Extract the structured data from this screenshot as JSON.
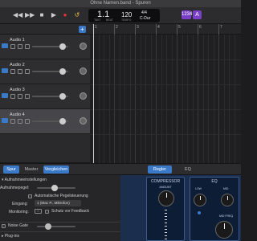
{
  "window": {
    "title": "Ohne Namen.band - Spuren"
  },
  "transport": {
    "rewind": "◀◀",
    "forward": "▶▶",
    "stop": "■",
    "play": "▶",
    "record": "●",
    "cycle": "↺"
  },
  "lcd": {
    "position": "1.1",
    "bar_label": "TAKT",
    "beat_label": "BEAT",
    "tempo": "120",
    "tempo_label": "TEMPO",
    "signature": "4/4",
    "key": "C-Dur"
  },
  "badges": {
    "count_in": "1234",
    "tuner": "A"
  },
  "track_header": {
    "add": "+"
  },
  "ruler": {
    "marks": [
      "1",
      "2",
      "3",
      "4",
      "5",
      "6",
      "7"
    ]
  },
  "tracks": [
    {
      "name": "Audio 1",
      "selected": false,
      "volume": 0.7
    },
    {
      "name": "Audio 2",
      "selected": false,
      "volume": 0.7
    },
    {
      "name": "Audio 3",
      "selected": false,
      "volume": 0.7
    },
    {
      "name": "Audio 4",
      "selected": true,
      "volume": 0.7
    }
  ],
  "tabs": {
    "spur": "Spur",
    "master": "Master",
    "vergleichen": "Vergleichen",
    "regler": "Regler",
    "eq": "EQ"
  },
  "inspector": {
    "section_recording": "Aufnahmeeinstellungen",
    "input_level_label": "Aufnahmepegel:",
    "auto_level": "Automatische Pegelsteuerung",
    "input_label": "Eingang:",
    "input_value": "1 (Mac P...Mikrofon)",
    "monitoring_label": "Monitoring:",
    "feedback_protect": "Schutz vor Feedback",
    "noise_gate": "Noise Gate",
    "plugins": "Plug-ins"
  },
  "plugin": {
    "compressor_title": "COMPRESSOR",
    "compressor_amount": "AMOUNT",
    "eq_title": "EQ",
    "eq_low": "LOW",
    "eq_mid": "MID",
    "eq_mid_freq": "MID FREQ"
  },
  "colors": {
    "accent": "#3a78c8",
    "badge": "#7a3fc8",
    "plugin_bg": "#1b2e4e"
  }
}
